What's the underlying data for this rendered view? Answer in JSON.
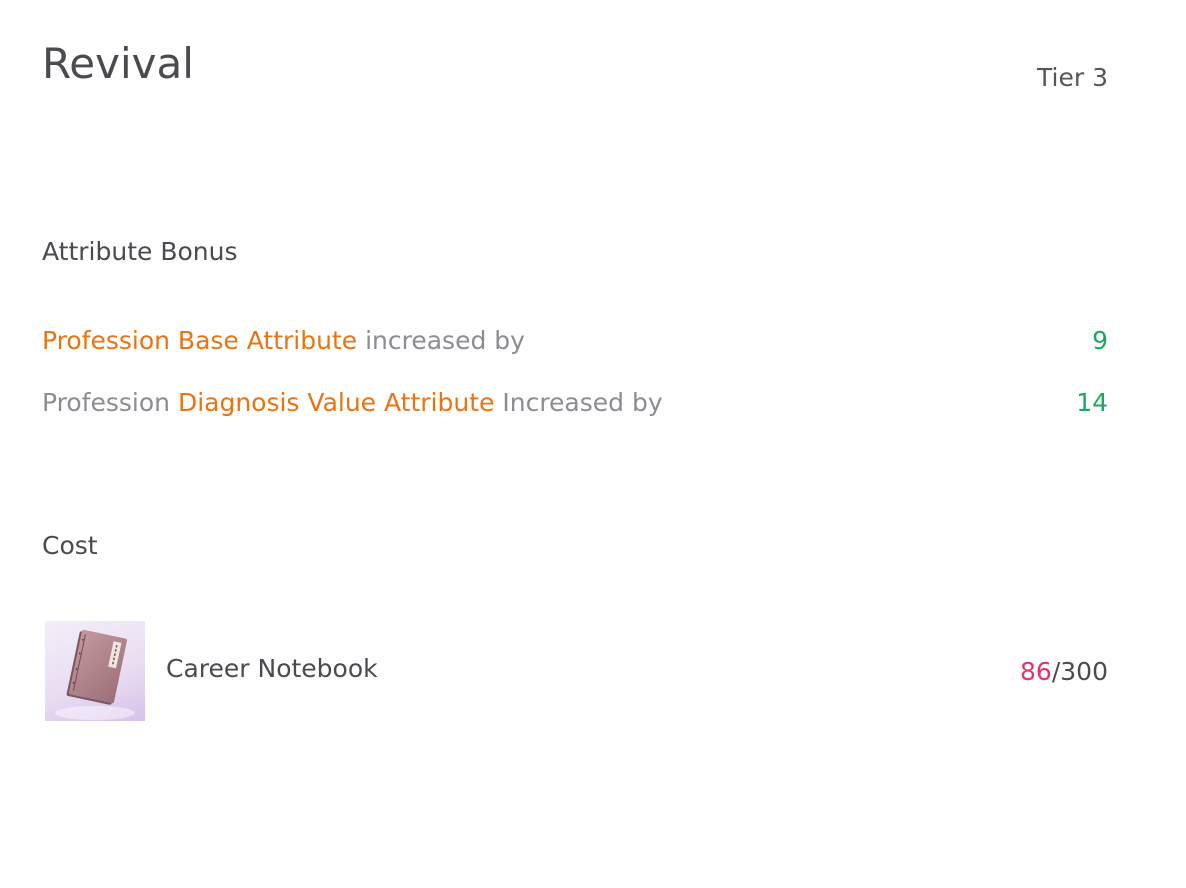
{
  "header": {
    "title": "Revival",
    "tier": "Tier 3"
  },
  "attribute_bonus": {
    "heading": "Attribute Bonus",
    "rows": [
      {
        "highlight": "Profession Base Attribute",
        "suffix": "increased by",
        "value": "9"
      },
      {
        "prefix": "Profession",
        "highlight": "Diagnosis Value Attribute",
        "suffix": "Increased by",
        "value": "14"
      }
    ]
  },
  "cost": {
    "heading": "Cost",
    "item": {
      "icon": "notebook-icon",
      "name": "Career Notebook",
      "have": "86",
      "separator": "/",
      "required": "300"
    }
  },
  "colors": {
    "highlight": "#ea7412",
    "value_green": "#1aa864",
    "insufficient_red": "#e8336a",
    "muted_text": "#8c8c92",
    "primary_text": "#4a4a50"
  }
}
